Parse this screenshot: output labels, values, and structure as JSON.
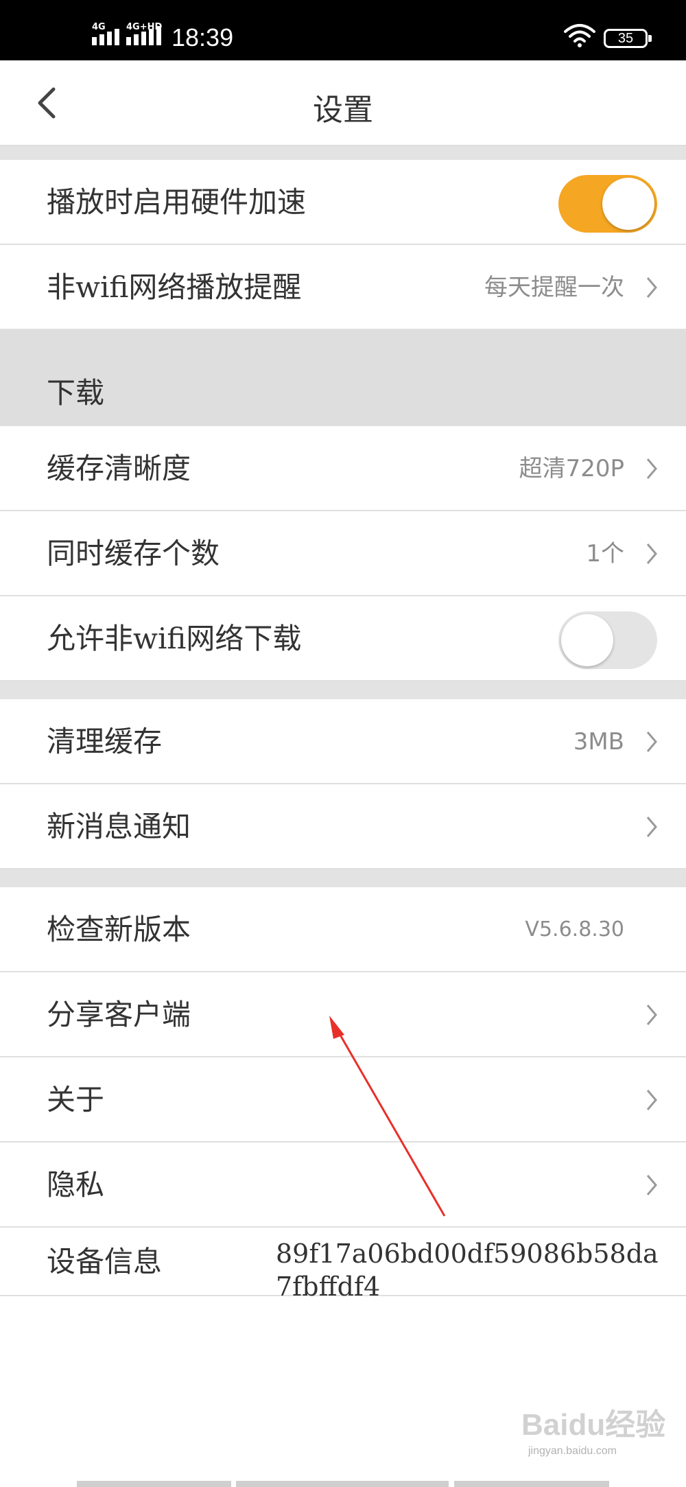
{
  "status": {
    "signal1": "4G",
    "signal2": "4G+HD",
    "time": "18:39",
    "battery": "35"
  },
  "header": {
    "title": "设置"
  },
  "rows": {
    "hw_accel": {
      "label": "播放时启用硬件加速",
      "enabled": true
    },
    "non_wifi_play": {
      "label": "非wifi网络播放提醒",
      "value": "每天提醒一次"
    },
    "download_section": "下载",
    "cache_quality": {
      "label": "缓存清晰度",
      "value": "超清720P"
    },
    "concurrent": {
      "label": "同时缓存个数",
      "value": "1个"
    },
    "allow_non_wifi": {
      "label": "允许非wifi网络下载",
      "enabled": false
    },
    "clear_cache": {
      "label": "清理缓存",
      "value": "3MB"
    },
    "notifications": {
      "label": "新消息通知"
    },
    "check_version": {
      "label": "检查新版本",
      "value": "V5.6.8.30"
    },
    "share": {
      "label": "分享客户端"
    },
    "about": {
      "label": "关于"
    },
    "privacy": {
      "label": "隐私"
    },
    "device": {
      "label": "设备信息",
      "value": "89f17a06bd00df59086b58da7fbffdf4"
    }
  },
  "colors": {
    "accent": "#f5a623",
    "annotation": "#e8302a"
  },
  "watermark": {
    "brand": "Baidu经验",
    "url": "jingyan.baidu.com"
  }
}
